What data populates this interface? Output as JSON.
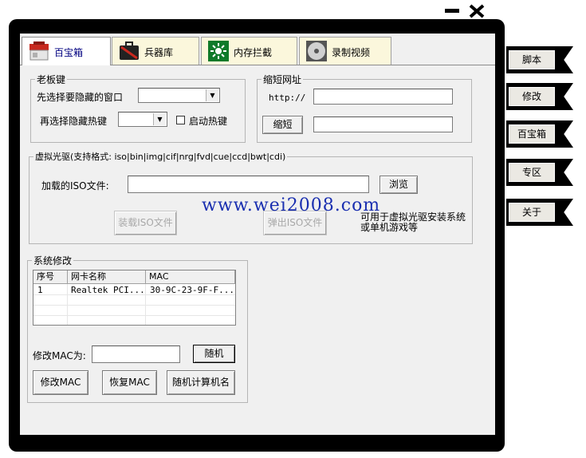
{
  "window_controls": {
    "minimize_icon": "minimize-icon",
    "close_icon": "close-icon"
  },
  "tabs": [
    {
      "label": "百宝箱",
      "icon": "toolbox-icon",
      "active": true
    },
    {
      "label": "兵器库",
      "icon": "weapon-case-icon",
      "active": false
    },
    {
      "label": "内存拦截",
      "icon": "memory-chip-icon",
      "active": false
    },
    {
      "label": "录制视频",
      "icon": "video-disc-icon",
      "active": false
    }
  ],
  "boss_key": {
    "title": "老板键",
    "select_window_label": "先选择要隐藏的窗口",
    "select_window_value": "",
    "hotkey_label": "再选择隐藏热键",
    "hotkey_value": "",
    "enable_hotkey_label": "启动热键",
    "enable_hotkey_checked": false
  },
  "short_url": {
    "title": "缩短网址",
    "http_prefix": "http://",
    "url_value": "",
    "shorten_button": "缩短",
    "result_value": ""
  },
  "virtual_drive": {
    "title": "虚拟光驱(支持格式: iso|bin|img|cif|nrg|fvd|cue|ccd|bwt|cdi)",
    "loaded_iso_label": "加载的ISO文件:",
    "iso_path_value": "",
    "browse_button": "浏览",
    "mount_button": "装载ISO文件",
    "eject_button": "弹出ISO文件",
    "note_line1": "可用于虚拟光驱安装系统",
    "note_line2": "或单机游戏等"
  },
  "watermark": "www.wei2008.com",
  "system_modify": {
    "title": "系统修改",
    "columns": [
      "序号",
      "网卡名称",
      "MAC"
    ],
    "rows": [
      [
        "1",
        "Realtek PCI...",
        "30-9C-23-9F-F..."
      ]
    ],
    "modify_mac_label": "修改MAC为:",
    "mac_value": "",
    "random_button": "随机",
    "modify_mac_button": "修改MAC",
    "restore_mac_button": "恢复MAC",
    "random_name_button": "随机计算机名"
  },
  "side_menu": [
    "脚本",
    "修改",
    "百宝箱",
    "专区",
    "关于"
  ]
}
